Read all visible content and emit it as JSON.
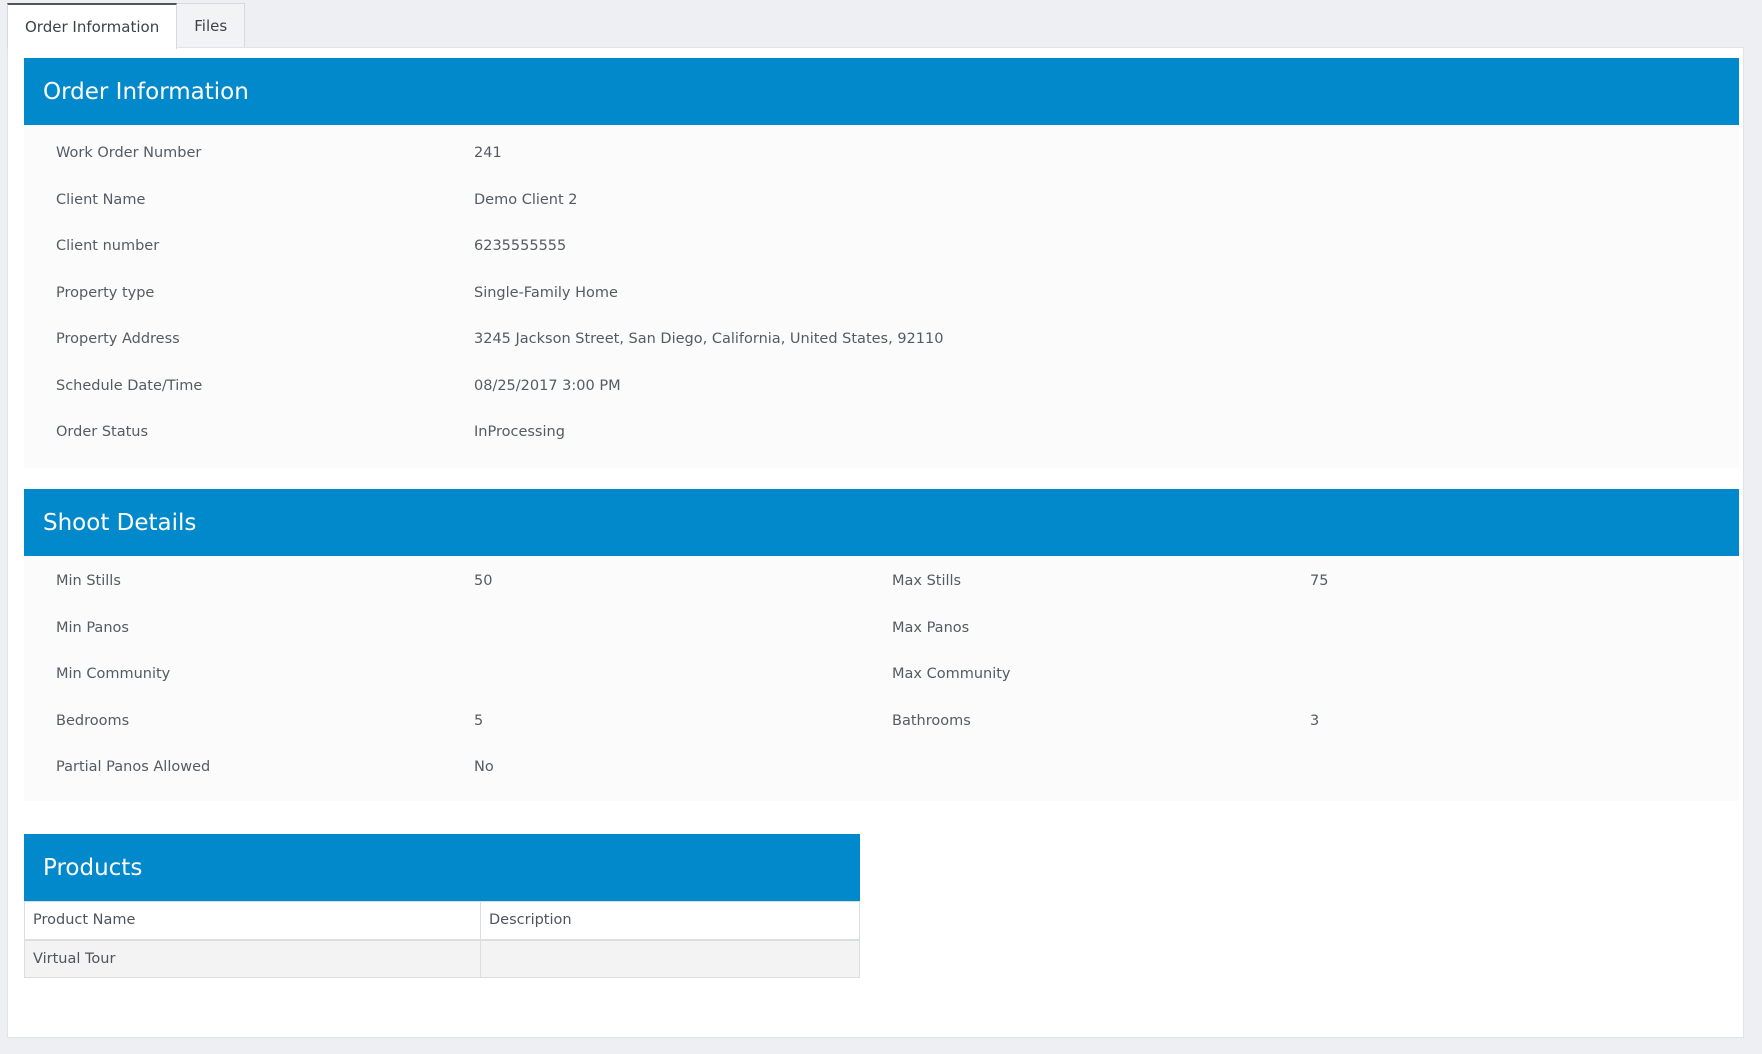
{
  "tabs": [
    {
      "label": "Order Information",
      "active": true
    },
    {
      "label": "Files",
      "active": false
    }
  ],
  "order_information": {
    "title": "Order Information",
    "fields": [
      {
        "label": "Work Order Number",
        "value": "241"
      },
      {
        "label": "Client Name",
        "value": "Demo Client 2"
      },
      {
        "label": "Client number",
        "value": "6235555555"
      },
      {
        "label": "Property type",
        "value": "Single-Family Home"
      },
      {
        "label": "Property Address",
        "value": "3245 Jackson Street, San Diego, California, United States, 92110"
      },
      {
        "label": "Schedule Date/Time",
        "value": "08/25/2017 3:00 PM"
      },
      {
        "label": "Order Status",
        "value": "InProcessing"
      }
    ]
  },
  "shoot_details": {
    "title": "Shoot Details",
    "rows": [
      {
        "left_label": "Min Stills",
        "left_value": "50",
        "right_label": "Max Stills",
        "right_value": "75"
      },
      {
        "left_label": "Min Panos",
        "left_value": "",
        "right_label": "Max Panos",
        "right_value": ""
      },
      {
        "left_label": "Min Community",
        "left_value": "",
        "right_label": "Max Community",
        "right_value": ""
      },
      {
        "left_label": "Bedrooms",
        "left_value": "5",
        "right_label": "Bathrooms",
        "right_value": "3"
      },
      {
        "left_label": "Partial Panos Allowed",
        "left_value": "No",
        "right_label": "",
        "right_value": ""
      }
    ]
  },
  "products": {
    "title": "Products",
    "columns": [
      "Product Name",
      "Description"
    ],
    "rows": [
      [
        "Virtual Tour",
        ""
      ]
    ]
  },
  "colors": {
    "header_blue": "#0289cc",
    "page_bg": "#eeeff2"
  }
}
